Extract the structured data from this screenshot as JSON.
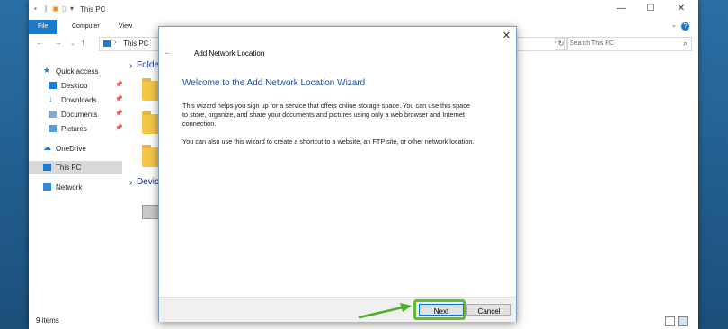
{
  "window": {
    "title": "This PC",
    "ribbon_tabs": [
      "File",
      "Computer",
      "View"
    ],
    "address_path": "This PC",
    "search_placeholder": "Search This PC",
    "status_count": "9 items"
  },
  "nav_pane": {
    "quick_access": "Quick access",
    "items": [
      "Desktop",
      "Downloads",
      "Documents",
      "Pictures"
    ],
    "onedrive": "OneDrive",
    "this_pc": "This PC",
    "network": "Network"
  },
  "content": {
    "folders_group": "Folde",
    "devices_group": "Devic"
  },
  "dialog": {
    "title": "Add Network Location",
    "heading": "Welcome to the Add Network Location Wizard",
    "para1_line1": "This wizard helps you sign up for a service that offers online storage space.  You can use this space",
    "para1_line2": "to store, organize, and share your documents and pictures using only a web browser and Internet",
    "para1_line3": "connection.",
    "para2": "You can also use this wizard to create a shortcut to a website, an FTP site, or other network location.",
    "next_label": "Next",
    "cancel_label": "Cancel"
  },
  "colors": {
    "accent": "#1979ca",
    "heading_blue": "#1d4fa0",
    "highlight_green": "#5fbf2f",
    "arrow_green": "#4caf2a"
  },
  "icons": [
    "back-arrow-icon",
    "forward-arrow-icon",
    "up-arrow-icon",
    "refresh-icon",
    "search-icon",
    "close-icon",
    "pin-icon",
    "star-icon",
    "cloud-icon",
    "computer-icon",
    "network-icon",
    "folder-icon",
    "drive-icon"
  ]
}
